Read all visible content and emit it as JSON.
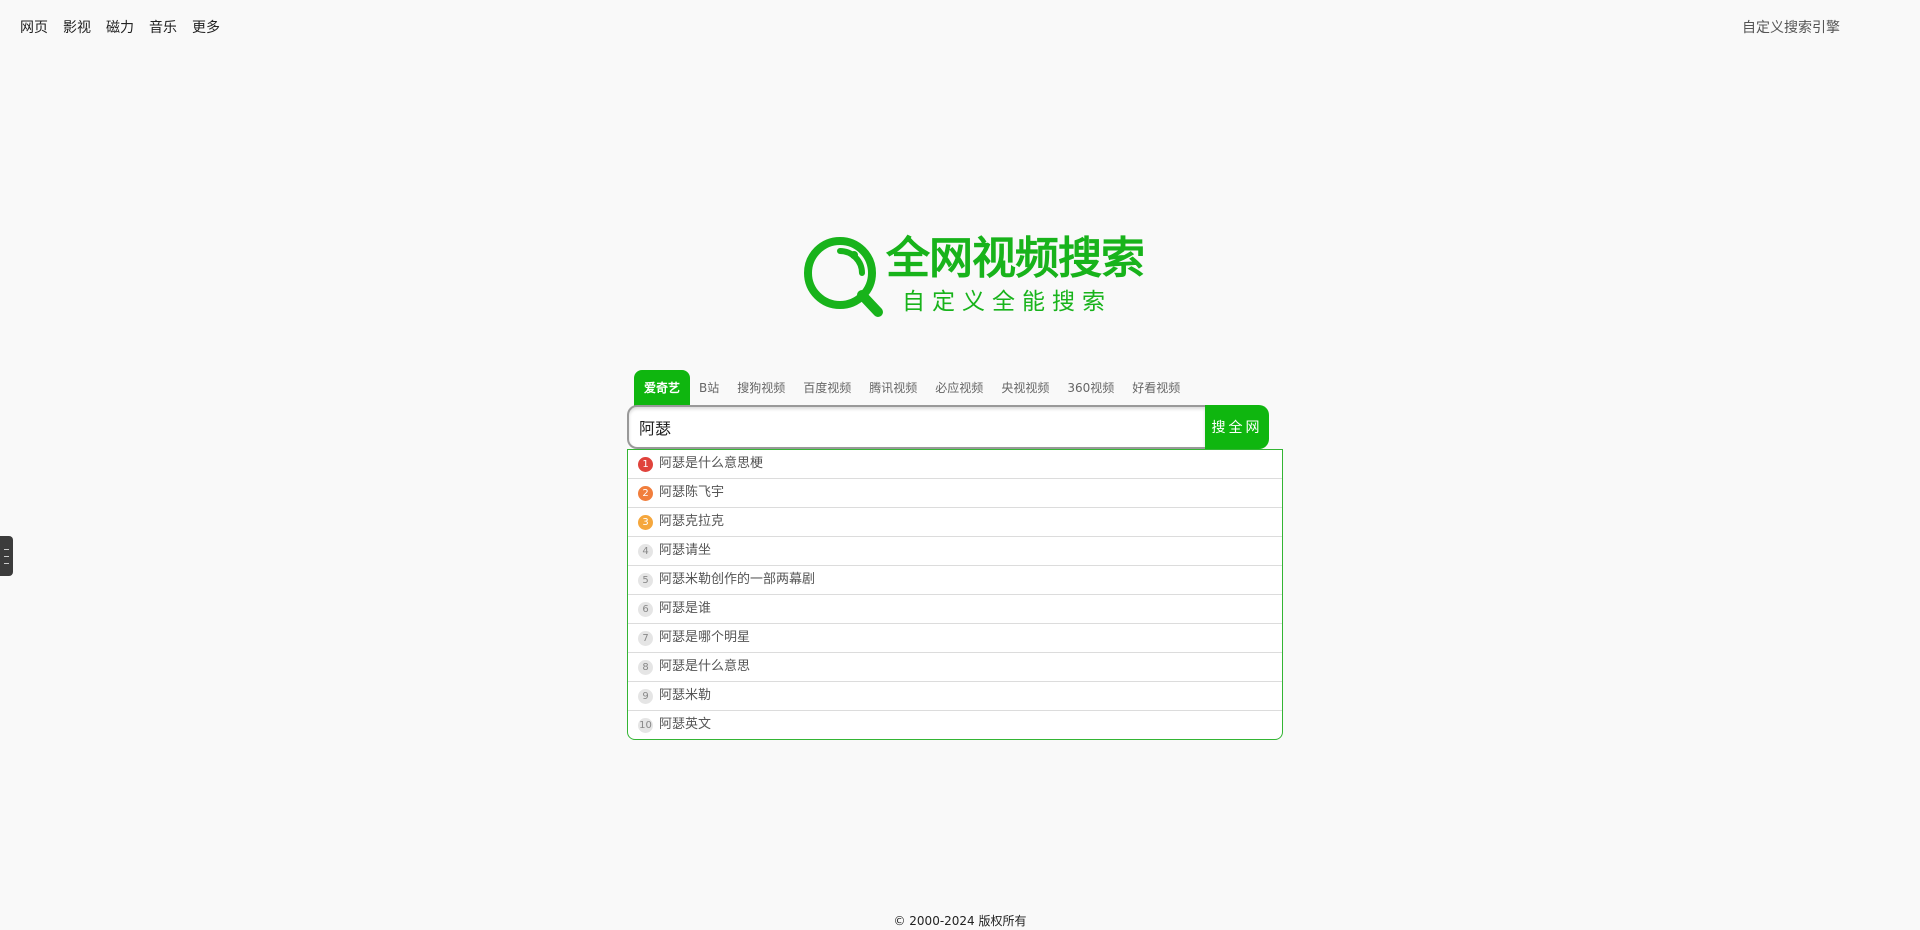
{
  "nav": {
    "items": [
      {
        "label": "网页"
      },
      {
        "label": "影视"
      },
      {
        "label": "磁力"
      },
      {
        "label": "音乐"
      },
      {
        "label": "更多"
      }
    ],
    "custom_engine_label": "自定义搜索引擎"
  },
  "logo": {
    "title": "全网视频搜索",
    "subtitle": "自定义全能搜索",
    "color": "#18b31b",
    "icon": "magnifier-icon"
  },
  "engine_tabs": [
    {
      "label": "爱奇艺",
      "active": true
    },
    {
      "label": "B站"
    },
    {
      "label": "搜狗视频"
    },
    {
      "label": "百度视频"
    },
    {
      "label": "腾讯视频"
    },
    {
      "label": "必应视频"
    },
    {
      "label": "央视视频"
    },
    {
      "label": "360视频"
    },
    {
      "label": "好看视频"
    }
  ],
  "search": {
    "value": "阿瑟",
    "button_label": "搜全网",
    "accent": "#0fb60f"
  },
  "suggestions": [
    {
      "rank": "1",
      "text": "阿瑟是什么意思梗"
    },
    {
      "rank": "2",
      "text": "阿瑟陈飞宇"
    },
    {
      "rank": "3",
      "text": "阿瑟克拉克"
    },
    {
      "rank": "4",
      "text": "阿瑟请坐"
    },
    {
      "rank": "5",
      "text": "阿瑟米勒创作的一部两幕剧"
    },
    {
      "rank": "6",
      "text": "阿瑟是谁"
    },
    {
      "rank": "7",
      "text": "阿瑟是哪个明星"
    },
    {
      "rank": "8",
      "text": "阿瑟是什么意思"
    },
    {
      "rank": "9",
      "text": "阿瑟米勒"
    },
    {
      "rank": "10",
      "text": "阿瑟英文"
    }
  ],
  "footer": {
    "copyright": "© 2000-2024  版权所有"
  }
}
